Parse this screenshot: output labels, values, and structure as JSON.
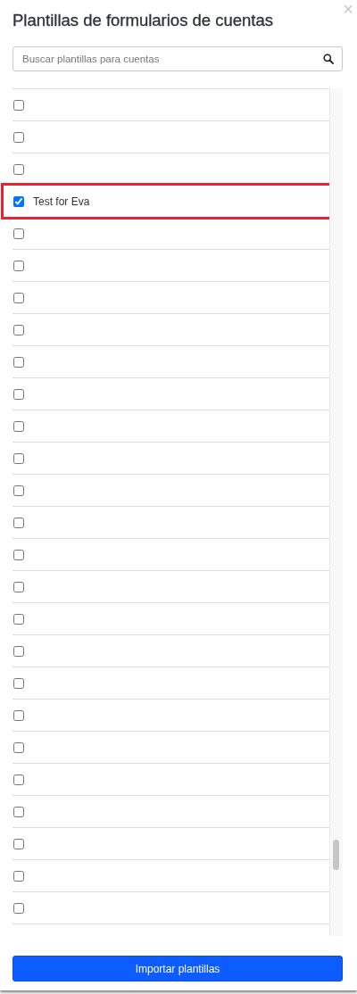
{
  "dialog": {
    "title": "Plantillas de formularios de cuentas",
    "close_label": "×"
  },
  "search": {
    "placeholder": "Buscar plantillas para cuentas"
  },
  "templates": [
    {
      "checked": false,
      "highlighted": false
    },
    {
      "checked": false,
      "highlighted": false
    },
    {
      "checked": false,
      "highlighted": false
    },
    {
      "label": "Test for Eva",
      "checked": true,
      "highlighted": true
    },
    {
      "checked": false,
      "highlighted": false
    },
    {
      "checked": false,
      "highlighted": false
    },
    {
      "checked": false,
      "highlighted": false
    },
    {
      "checked": false,
      "highlighted": false
    },
    {
      "checked": false,
      "highlighted": false
    },
    {
      "checked": false,
      "highlighted": false
    },
    {
      "checked": false,
      "highlighted": false
    },
    {
      "checked": false,
      "highlighted": false
    },
    {
      "checked": false,
      "highlighted": false
    },
    {
      "checked": false,
      "highlighted": false
    },
    {
      "checked": false,
      "highlighted": false
    },
    {
      "checked": false,
      "highlighted": false
    },
    {
      "checked": false,
      "highlighted": false
    },
    {
      "checked": false,
      "highlighted": false
    },
    {
      "checked": false,
      "highlighted": false
    },
    {
      "checked": false,
      "highlighted": false
    },
    {
      "checked": false,
      "highlighted": false
    },
    {
      "checked": false,
      "highlighted": false
    },
    {
      "checked": false,
      "highlighted": false
    },
    {
      "checked": false,
      "highlighted": false
    },
    {
      "checked": false,
      "highlighted": false
    },
    {
      "checked": false,
      "highlighted": false
    }
  ],
  "import_button": "Importar plantillas"
}
